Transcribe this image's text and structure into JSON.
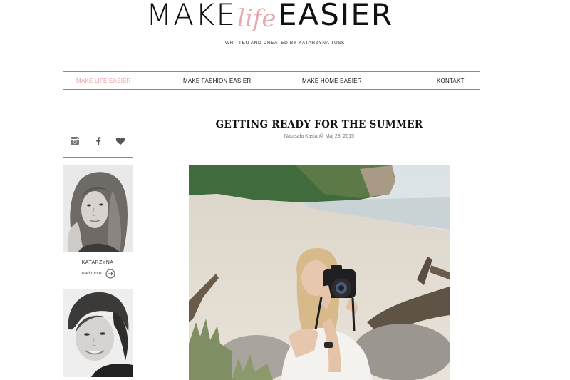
{
  "header": {
    "logo_make": "MAKE",
    "logo_life": "life",
    "logo_easier": "EASIER",
    "tagline": "WRITTEN AND CREATED BY KATARZYNA TUSK"
  },
  "nav": {
    "items": [
      {
        "label": "MAKE LIFE EASIER",
        "active": true
      },
      {
        "label": "MAKE FASHION EASIER",
        "active": false
      },
      {
        "label": "MAKE HOME EASIER",
        "active": false
      },
      {
        "label": "KONTAKT",
        "active": false
      }
    ]
  },
  "post": {
    "title": "GETTING READY FOR THE SUMMER",
    "meta": "Napisała Kasia @ Maj 28, 2015"
  },
  "sidebar": {
    "social_icons": [
      "instagram-icon",
      "facebook-icon",
      "heart-icon"
    ],
    "authors": [
      {
        "name": "KATARZYNA",
        "read_more": "read more"
      }
    ]
  },
  "colors": {
    "accent": "#e7a1a8",
    "text": "#111111",
    "rule": "#8c8c8c"
  }
}
